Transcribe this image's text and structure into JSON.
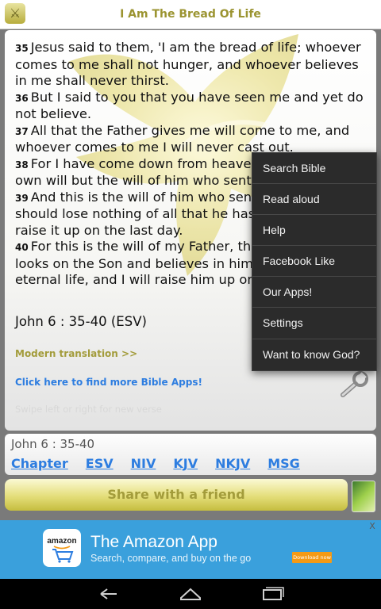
{
  "titlebar": {
    "title": "I Am The Bread Of Life"
  },
  "passage": {
    "verses": [
      {
        "num": "35",
        "text": "Jesus said to them, 'I am the bread of life; whoever comes to me shall not hunger, and whoever believes in me shall never thirst."
      },
      {
        "num": "36",
        "text": "But I said to you that you have seen me and yet do not believe."
      },
      {
        "num": "37",
        "text": "All that the Father gives me will come to me, and whoever comes to me I will never cast out."
      },
      {
        "num": "38",
        "text": "For I have come down from heaven, not to do my own will but the will of him who sent me."
      },
      {
        "num": "39",
        "text": "And this is the will of him who sent me, that I should lose nothing of all that he has given me, but raise it up on the last day."
      },
      {
        "num": "40",
        "text": "For this is the will of my Father, that everyone who looks on the Son and believes in him should have eternal life, and I will raise him up on the last day.'"
      }
    ],
    "reference": "John 6 : 35-40  (ESV)",
    "modern_link": "Modern translation >>",
    "apps_link": "Click here to find more Bible Apps!",
    "swipe_hint": "Swipe left or right for new verse"
  },
  "refbar": {
    "reference": "John 6 : 35-40",
    "links": [
      "Chapter",
      "ESV",
      "NIV",
      "KJV",
      "NKJV",
      "MSG"
    ]
  },
  "share": {
    "label": "Share with a friend"
  },
  "ad": {
    "brand": "amazon",
    "title": "The Amazon App",
    "subtitle": "Search, compare, and buy on the go",
    "button": "Download now",
    "close": "X"
  },
  "menu": {
    "items": [
      "Search Bible",
      "Read aloud",
      "Help",
      "Facebook Like",
      "Our Apps!",
      "Settings",
      "Want to know God?"
    ]
  },
  "icons": {
    "app": "app-icon",
    "wrench": "wrench-icon",
    "back": "back-icon",
    "home": "home-icon",
    "recents": "recents-icon"
  },
  "colors": {
    "title": "#9b9431",
    "link_blue": "#2d7de0",
    "gold": "#a39c3b",
    "ad_bg": "#3aa0dc",
    "menu_bg": "#2b2b2b"
  }
}
